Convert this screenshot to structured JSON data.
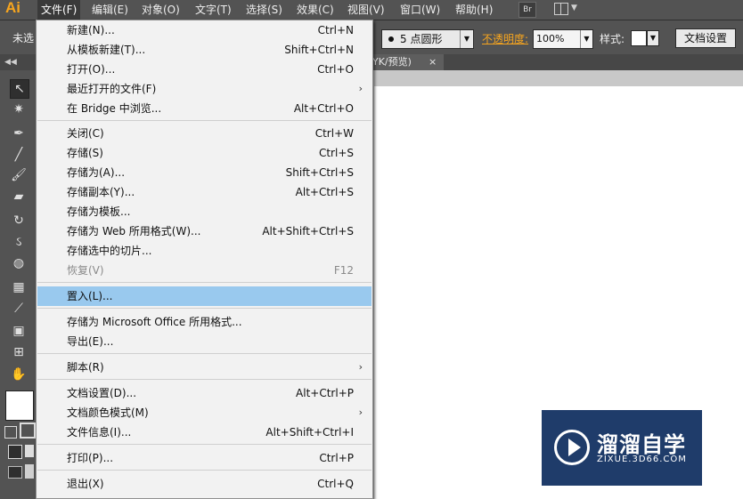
{
  "app": {
    "logo_text": "Ai"
  },
  "menubar": {
    "items": [
      {
        "label": "文件(F)"
      },
      {
        "label": "编辑(E)"
      },
      {
        "label": "对象(O)"
      },
      {
        "label": "文字(T)"
      },
      {
        "label": "选择(S)"
      },
      {
        "label": "效果(C)"
      },
      {
        "label": "视图(V)"
      },
      {
        "label": "窗口(W)"
      },
      {
        "label": "帮助(H)"
      }
    ],
    "bridge_label": "Br"
  },
  "control_bar": {
    "selection_text": "未选",
    "brush_value": "5 点圆形",
    "opacity_label": "不透明度:",
    "opacity_value": "100%",
    "style_label": "样式:",
    "doc_setup_button": "文档设置"
  },
  "document_tab": {
    "label": "YK/预览)",
    "close_glyph": "×"
  },
  "file_menu": {
    "items": [
      {
        "label": "新建(N)...",
        "shortcut": "Ctrl+N"
      },
      {
        "label": "从模板新建(T)...",
        "shortcut": "Shift+Ctrl+N"
      },
      {
        "label": "打开(O)...",
        "shortcut": "Ctrl+O"
      },
      {
        "label": "最近打开的文件(F)",
        "shortcut": ""
      },
      {
        "label": "在 Bridge 中浏览...",
        "shortcut": "Alt+Ctrl+O"
      },
      {
        "label": "关闭(C)",
        "shortcut": "Ctrl+W"
      },
      {
        "label": "存储(S)",
        "shortcut": "Ctrl+S"
      },
      {
        "label": "存储为(A)...",
        "shortcut": "Shift+Ctrl+S"
      },
      {
        "label": "存储副本(Y)...",
        "shortcut": "Alt+Ctrl+S"
      },
      {
        "label": "存储为模板...",
        "shortcut": ""
      },
      {
        "label": "存储为 Web 所用格式(W)...",
        "shortcut": "Alt+Shift+Ctrl+S"
      },
      {
        "label": "存储选中的切片...",
        "shortcut": ""
      },
      {
        "label": "恢复(V)",
        "shortcut": "F12"
      },
      {
        "label": "置入(L)...",
        "shortcut": ""
      },
      {
        "label": "存储为 Microsoft Office 所用格式...",
        "shortcut": ""
      },
      {
        "label": "导出(E)...",
        "shortcut": ""
      },
      {
        "label": "脚本(R)",
        "shortcut": ""
      },
      {
        "label": "文档设置(D)...",
        "shortcut": "Alt+Ctrl+P"
      },
      {
        "label": "文档颜色模式(M)",
        "shortcut": ""
      },
      {
        "label": "文件信息(I)...",
        "shortcut": "Alt+Shift+Ctrl+I"
      },
      {
        "label": "打印(P)...",
        "shortcut": "Ctrl+P"
      },
      {
        "label": "退出(X)",
        "shortcut": "Ctrl+Q"
      }
    ],
    "highlight_color": "#99c9ee"
  },
  "watermark": {
    "title": "溜溜自学",
    "url": "ZIXUE.3D66.COM",
    "bg_color": "#1f3c6a"
  },
  "colors": {
    "accent": "#f7a51e",
    "panel": "#535353"
  }
}
